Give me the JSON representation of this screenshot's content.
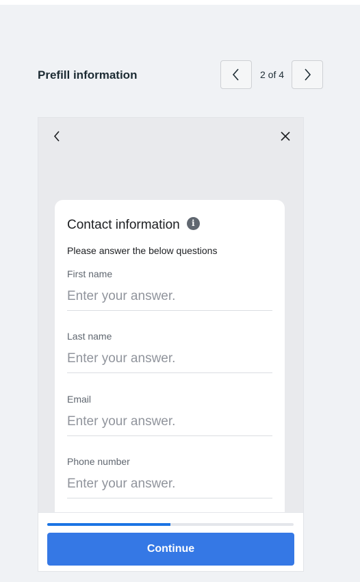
{
  "header": {
    "title": "Prefill information",
    "pager": "2 of 4"
  },
  "preview": {
    "card": {
      "title": "Contact information",
      "subtitle": "Please answer the below questions",
      "fields": [
        {
          "label": "First name",
          "placeholder": "Enter your answer."
        },
        {
          "label": "Last name",
          "placeholder": "Enter your answer."
        },
        {
          "label": "Email",
          "placeholder": "Enter your answer."
        },
        {
          "label": "Phone number",
          "placeholder": "Enter your answer."
        }
      ]
    },
    "progress": 0.5,
    "continue_label": "Continue"
  },
  "icons": {
    "back": "chevron-left-icon",
    "forward": "chevron-right-icon",
    "close": "close-icon",
    "info": "info-icon"
  },
  "colors": {
    "accent": "#3578e5",
    "progress": "#1b74e4",
    "background": "#f0f2f5"
  }
}
